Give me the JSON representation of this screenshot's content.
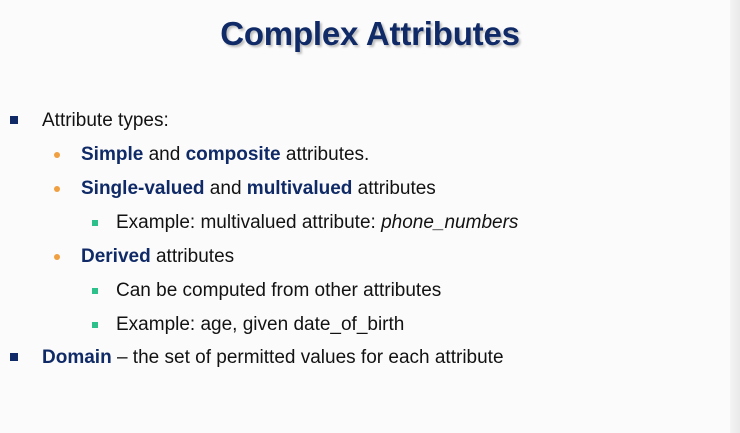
{
  "slide": {
    "title": "Complex Attributes",
    "items": [
      {
        "level": 1,
        "text": "Attribute types:"
      },
      {
        "level": 2,
        "hl1": "Simple",
        "t1": " and ",
        "hl2": "composite",
        "t2": " attributes."
      },
      {
        "level": 2,
        "hl1": "Single-valued",
        "t1": " and ",
        "hl2": "multivalued",
        "t2": " attributes"
      },
      {
        "level": 3,
        "text": "Example: multivalued attribute: ",
        "italic": "phone_numbers"
      },
      {
        "level": 2,
        "hl1": "Derived",
        "t1": " attributes"
      },
      {
        "level": 3,
        "text": "Can be computed from other attributes"
      },
      {
        "level": 3,
        "text": "Example:  age, given date_of_birth"
      },
      {
        "level": 1,
        "hl1": "Domain",
        "t1": " – the set of permitted values for each attribute"
      }
    ]
  },
  "colors": {
    "title": "#0f2a66",
    "highlight": "#0f2a66",
    "bullet_level1": "#0f2a66",
    "bullet_level2": "#f0a040",
    "bullet_level3": "#2ec08a",
    "body_text": "#121212"
  }
}
